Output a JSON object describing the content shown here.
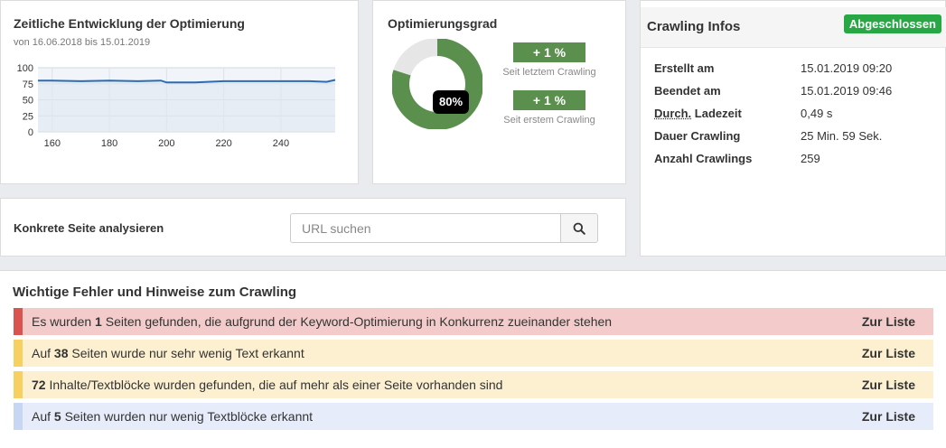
{
  "chart_card": {
    "title": "Zeitliche Entwicklung der Optimierung",
    "subtitle": "von 16.06.2018 bis 15.01.2019"
  },
  "chart_data": {
    "type": "area",
    "title": "",
    "xlabel": "",
    "ylabel": "",
    "xlim": [
      155,
      259
    ],
    "ylim": [
      0,
      100
    ],
    "x_ticks": [
      160,
      180,
      200,
      220,
      240
    ],
    "y_ticks": [
      0,
      25,
      50,
      75,
      100
    ],
    "grid": true,
    "series": [
      {
        "color": "#2c6db2",
        "x": [
          155,
          160,
          170,
          180,
          190,
          198,
          200,
          210,
          220,
          230,
          240,
          250,
          256,
          259
        ],
        "y": [
          80,
          80,
          79,
          80,
          79,
          80,
          77,
          77,
          79,
          79,
          79,
          79,
          78,
          81
        ]
      }
    ]
  },
  "optimization": {
    "title": "Optimierungsgrad",
    "percent": 80,
    "percent_label": "80%",
    "change_last": "+ 1 %",
    "change_last_caption": "Seit letztem Crawling",
    "change_first": "+ 1 %",
    "change_first_caption": "Seit erstem Crawling",
    "colors": {
      "filled": "#5b8f4e",
      "empty": "#e6e6e6"
    }
  },
  "crawling_info": {
    "title": "Crawling Infos",
    "status": "Abgeschlossen",
    "created_label": "Erstellt am",
    "created_value": "15.01.2019 09:20",
    "finished_label": "Beendet am",
    "finished_value": "15.01.2019 09:46",
    "load_abbr": "Durch.",
    "load_label_rest": " Ladezeit",
    "load_value": "0,49 s",
    "duration_label": "Dauer Crawling",
    "duration_value": "25 Min. 59 Sek.",
    "count_label": "Anzahl Crawlings",
    "count_value": "259"
  },
  "search": {
    "label": "Konkrete Seite analysieren",
    "placeholder": "URL suchen",
    "value": ""
  },
  "issues": {
    "title": "Wichtige Fehler und Hinweise zum Crawling",
    "link_label": "Zur Liste",
    "items": [
      {
        "level": "danger",
        "pre": "Es wurden ",
        "count": "1",
        "post": " Seiten gefunden, die aufgrund der Keyword-Optimierung in Konkurrenz zueinander stehen"
      },
      {
        "level": "warning",
        "pre": "Auf ",
        "count": "38",
        "post": " Seiten wurde nur sehr wenig Text erkannt"
      },
      {
        "level": "warning",
        "pre": "",
        "count": "72",
        "post": " Inhalte/Textblöcke wurden gefunden, die auf mehr als einer Seite vorhanden sind"
      },
      {
        "level": "info",
        "pre": "Auf ",
        "count": "5",
        "post": " Seiten wurden nur wenig Textblöcke erkannt"
      }
    ]
  }
}
